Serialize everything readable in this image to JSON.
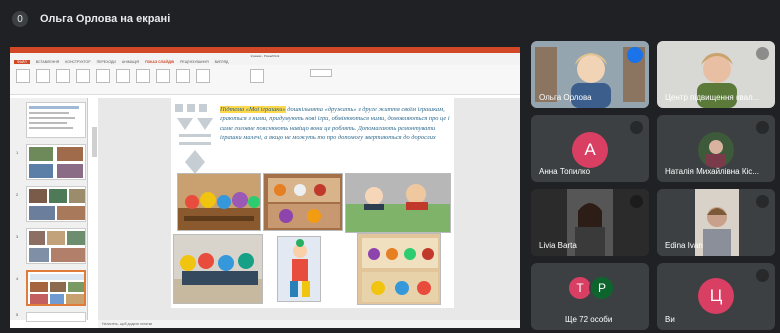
{
  "header": {
    "count": "0",
    "title": "Ольга Орлова на екрані"
  },
  "presentation": {
    "window_title": "Іграшки - PowerPoint",
    "tabs": [
      "ФАЙЛ",
      "ВСТАВЛЕННЯ",
      "КОНСТРУКТОР",
      "ПЕРЕХОДИ",
      "АНІМАЦІЯ",
      "ПОКАЗ СЛАЙДІВ",
      "РЕЦЕНЗУВАННЯ",
      "ВИГЛЯД"
    ],
    "slide_text_highlight": "Підтема «Мої іграшки»",
    "slide_text": "дошкільнята «дружать» з друге життя своїм іграшкам, граються з ними, придумують нові ігри, обмінюються ними, домовляються про це і саме головне пояснюють навіщо вони це роблять. Допомагають ремонтувати іграшки малечі, а якщо не можуть то про допомогу звертаються до дорослих",
    "notes_placeholder": "Натисніть, щоб додати нотатки",
    "thumb_numbers": [
      "1",
      "2",
      "3",
      "4",
      "5"
    ]
  },
  "participants": [
    {
      "name": "Ольга Орлова",
      "initial": "",
      "color": "#1a73e8"
    },
    {
      "name": "Центр підвищення квал...",
      "initial": "",
      "color": ""
    },
    {
      "name": "Анна Топилко",
      "initial": "А",
      "color": "#d93e63"
    },
    {
      "name": "Наталія Михайлівна Кіс...",
      "initial": "",
      "color": ""
    },
    {
      "name": "Livia Barta",
      "initial": "",
      "color": ""
    },
    {
      "name": "Edina Ivan",
      "initial": "",
      "color": ""
    },
    {
      "name": "Ще 72 особи",
      "initial": "",
      "color": ""
    },
    {
      "name": "Ви",
      "initial": "Ц",
      "color": "#d93e63"
    }
  ],
  "more_avatars": [
    {
      "initial": "Т",
      "color": "#d93e63"
    },
    {
      "initial": "Р",
      "color": "#0d652d"
    }
  ]
}
